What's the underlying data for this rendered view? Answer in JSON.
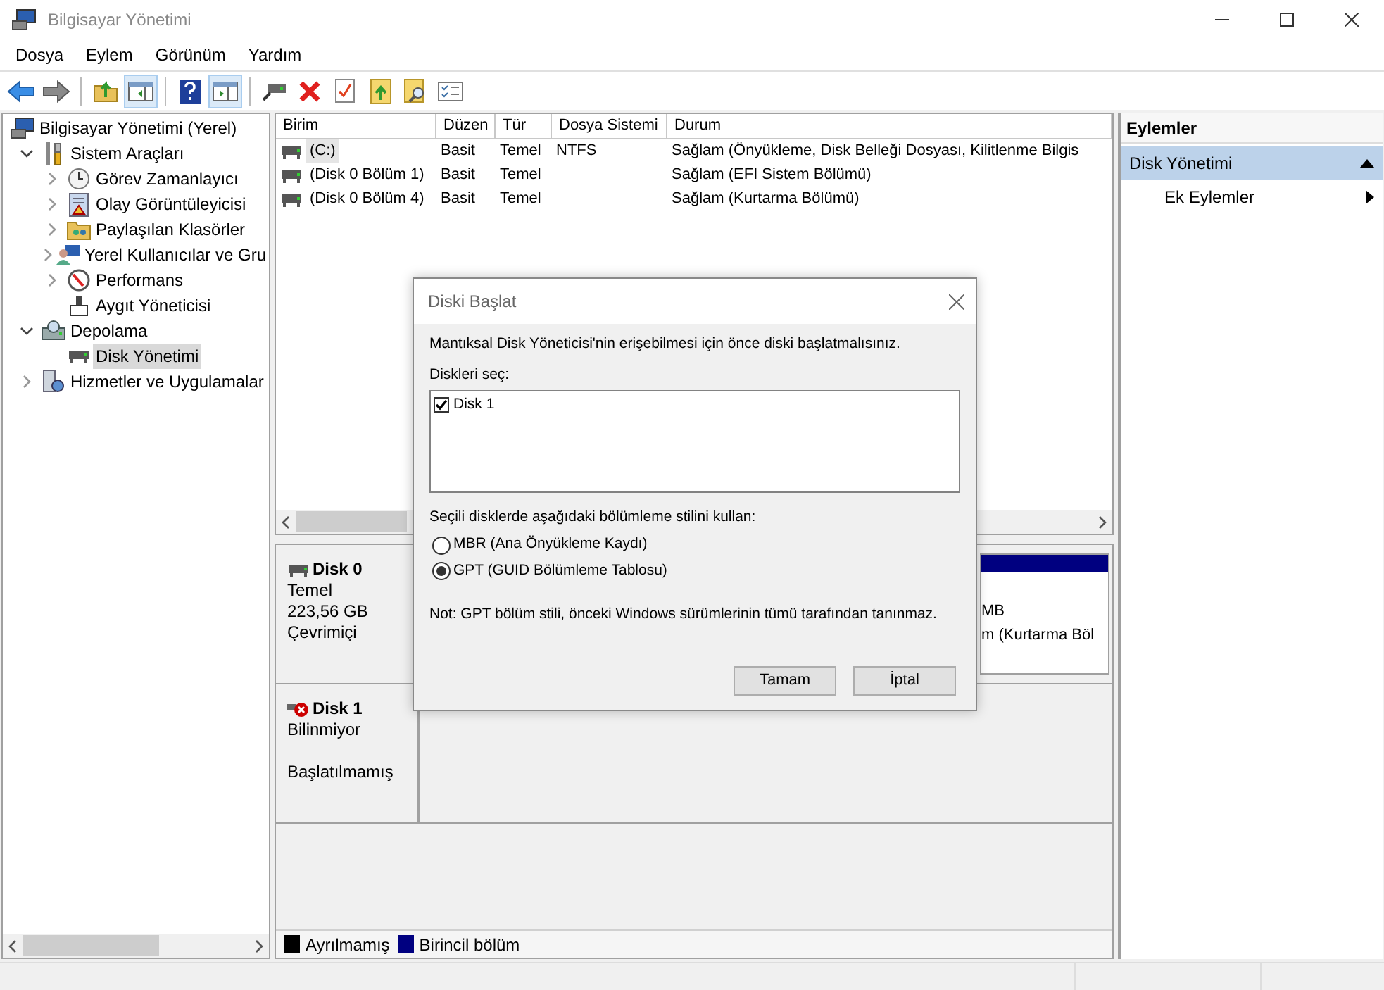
{
  "window": {
    "title": "Bilgisayar Yönetimi"
  },
  "menu": [
    "Dosya",
    "Eylem",
    "Görünüm",
    "Yardım"
  ],
  "toolbar": [
    {
      "kind": "back",
      "pressed": false
    },
    {
      "kind": "forward",
      "pressed": false
    },
    {
      "kind": "separator"
    },
    {
      "kind": "up",
      "pressed": false
    },
    {
      "kind": "tree",
      "pressed": true
    },
    {
      "kind": "separator"
    },
    {
      "kind": "help",
      "pressed": false
    },
    {
      "kind": "pane",
      "pressed": true
    },
    {
      "kind": "separator"
    },
    {
      "kind": "connect",
      "pressed": false
    },
    {
      "kind": "delete",
      "pressed": false
    },
    {
      "kind": "check",
      "pressed": false
    },
    {
      "kind": "upload",
      "pressed": false
    },
    {
      "kind": "find",
      "pressed": false
    },
    {
      "kind": "list",
      "pressed": false
    }
  ],
  "tree": [
    {
      "label": "Bilgisayar Yönetimi (Yerel)",
      "selected": false,
      "children": [
        {
          "label": "Sistem Araçları",
          "expanded": true,
          "selected": false,
          "children": [
            {
              "label": "Görev Zamanlayıcı",
              "expanded": false,
              "selected": false
            },
            {
              "label": "Olay Görüntüleyicisi",
              "expanded": false,
              "selected": false
            },
            {
              "label": "Paylaşılan Klasörler",
              "expanded": false,
              "selected": false
            },
            {
              "label": "Yerel Kullanıcılar ve Gru",
              "expanded": false,
              "selected": false
            },
            {
              "label": "Performans",
              "expanded": false,
              "selected": false
            },
            {
              "label": "Aygıt Yöneticisi",
              "selected": false
            }
          ]
        },
        {
          "label": "Depolama",
          "expanded": true,
          "selected": false,
          "children": [
            {
              "label": "Disk Yönetimi",
              "selected": true
            }
          ]
        },
        {
          "label": "Hizmetler ve Uygulamalar",
          "expanded": false,
          "selected": false
        }
      ]
    }
  ],
  "volumes": {
    "columns": [
      "Birim",
      "Düzen",
      "Tür",
      "Dosya Sistemi",
      "Durum"
    ],
    "rows": [
      {
        "cells": [
          "(C:)",
          "Basit",
          "Temel",
          "NTFS",
          "Sağlam (Önyükleme, Disk Belleği Dosyası, Kilitlenme Bilgis"
        ],
        "selected": true
      },
      {
        "cells": [
          "(Disk 0 Bölüm 1)",
          "Basit",
          "Temel",
          "",
          "Sağlam (EFI Sistem Bölümü)"
        ],
        "selected": false
      },
      {
        "cells": [
          "(Disk 0 Bölüm 4)",
          "Basit",
          "Temel",
          "",
          "Sağlam (Kurtarma Bölümü)"
        ],
        "selected": false
      }
    ]
  },
  "disks": [
    {
      "name": "Disk 0",
      "error": false,
      "type": "Temel",
      "size": "223,56 GB",
      "status": "Çevrimiçi",
      "partition": {
        "color": "#000080",
        "lines": [
          "MB",
          "m (Kurtarma Böl"
        ]
      }
    },
    {
      "name": "Disk 1",
      "error": true,
      "type": "Bilinmiyor",
      "status": "Başlatılmamış"
    }
  ],
  "legend": [
    {
      "label": "Ayrılmamış",
      "color": "#000000"
    },
    {
      "label": "Birincil bölüm",
      "color": "#000080"
    }
  ],
  "actions": {
    "title": "Eylemler",
    "sections": [
      {
        "label": "Disk Yönetimi",
        "expanded": true,
        "items": [
          "Ek Eylemler"
        ]
      }
    ]
  },
  "dialog": {
    "title": "Diski Başlat",
    "message": "Mantıksal Disk Yöneticisi'nin erişebilmesi için önce diski başlatmalısınız.",
    "list_label": "Diskleri seç:",
    "disks": [
      {
        "label": "Disk 1",
        "checked": true
      }
    ],
    "style_label": "Seçili disklerde aşağıdaki bölümleme stilini kullan:",
    "styles": [
      {
        "label": "MBR (Ana Önyükleme Kaydı)",
        "selected": false
      },
      {
        "label": "GPT (GUID Bölümleme Tablosu)",
        "selected": true
      }
    ],
    "note": "Not: GPT bölüm stili, önceki Windows sürümlerinin tümü tarafından tanınmaz.",
    "buttons": [
      "Tamam",
      "İptal"
    ]
  }
}
